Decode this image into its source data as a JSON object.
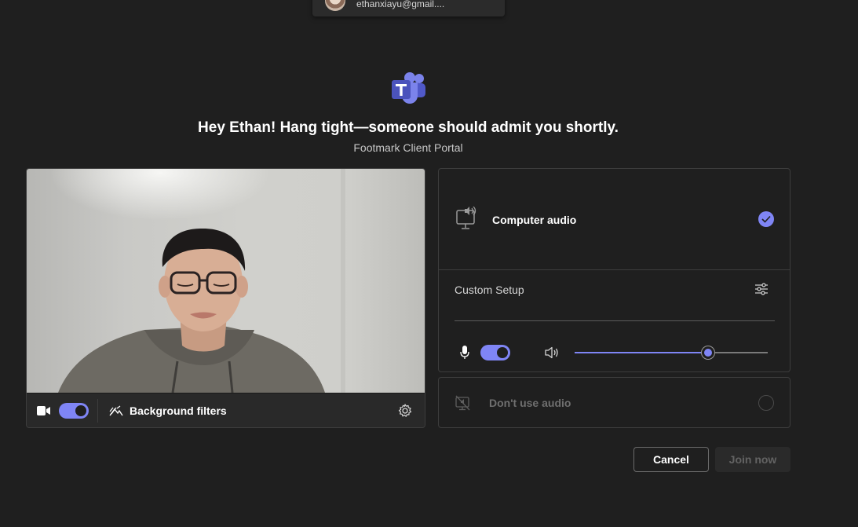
{
  "account": {
    "email": "ethanxiayu@gmail...."
  },
  "lobby": {
    "headline": "Hey Ethan! Hang tight—someone should admit you shortly.",
    "meeting_name": "Footmark Client Portal"
  },
  "video": {
    "camera_on": true,
    "background_filters_label": "Background filters"
  },
  "audio": {
    "computer_audio_label": "Computer audio",
    "computer_audio_selected": true,
    "custom_setup_label": "Custom Setup",
    "mic_on": true,
    "speaker_volume": 0.69,
    "dont_use_audio_label": "Don't use audio",
    "dont_use_audio_selected": false
  },
  "actions": {
    "cancel_label": "Cancel",
    "join_label": "Join now"
  },
  "colors": {
    "accent": "#7f85f5",
    "background": "#1f1f1f",
    "panel_border": "#3d3d3d",
    "disabled_text": "#636363"
  }
}
